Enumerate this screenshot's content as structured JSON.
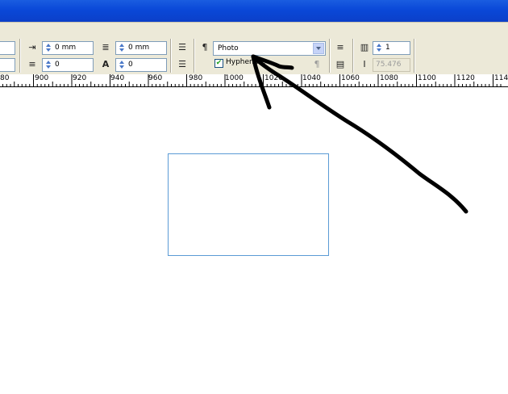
{
  "toolbar": {
    "left_indent_value": "0 mm",
    "space_before_value": "0 mm",
    "drop_cap_lines_value": "0",
    "drop_cap_chars_value": "0",
    "paragraph_style_value": "Photo",
    "hyphenate_label": "Hyphenate",
    "columns_value": "1",
    "gutter_value": "75.476 mr"
  },
  "ruler": {
    "labels": [
      "80",
      "900",
      "920",
      "940",
      "960",
      "980",
      "1000",
      "1020",
      "1040",
      "1060",
      "1080",
      "1100",
      "1120",
      "114"
    ]
  },
  "annotation": {
    "stroke_color": "#000000"
  },
  "colors": {
    "titlebar": "#0a48d8",
    "toolbar_bg": "#ece9d8",
    "frame_border": "#5b9bd5"
  }
}
